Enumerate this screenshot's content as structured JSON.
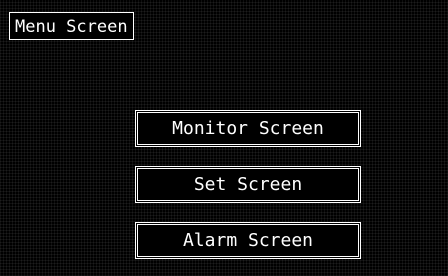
{
  "screen": {
    "title": "Menu Screen",
    "background_color": "#000000",
    "foreground_color": "#ffffff"
  },
  "menu": {
    "items": [
      {
        "label": "Monitor Screen"
      },
      {
        "label": "Set Screen"
      },
      {
        "label": "Alarm Screen"
      }
    ]
  }
}
